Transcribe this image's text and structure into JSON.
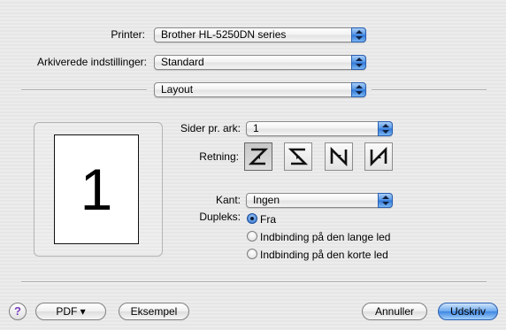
{
  "printer": {
    "label": "Printer:",
    "value": "Brother HL-5250DN series"
  },
  "presets": {
    "label": "Arkiverede indstillinger:",
    "value": "Standard"
  },
  "panel": {
    "value": "Layout"
  },
  "preview": {
    "page_number": "1"
  },
  "pages_per_sheet": {
    "label": "Sider pr. ark:",
    "value": "1"
  },
  "orientation": {
    "label": "Retning:",
    "options": [
      "z-icon",
      "s-reversed-icon",
      "n-reversed-icon",
      "n-icon"
    ],
    "selected_index": 0
  },
  "border": {
    "label": "Kant:",
    "value": "Ingen"
  },
  "duplex": {
    "label": "Dupleks:",
    "options": [
      "Fra",
      "Indbinding på den lange led",
      "Indbinding på den korte led"
    ],
    "selected": "Fra"
  },
  "footer": {
    "help": "?",
    "pdf": "PDF ▾",
    "preview": "Eksempel",
    "cancel": "Annuller",
    "print": "Udskriv"
  },
  "colors": {
    "accent": "#3f86e2",
    "help": "#7a3fbf"
  }
}
